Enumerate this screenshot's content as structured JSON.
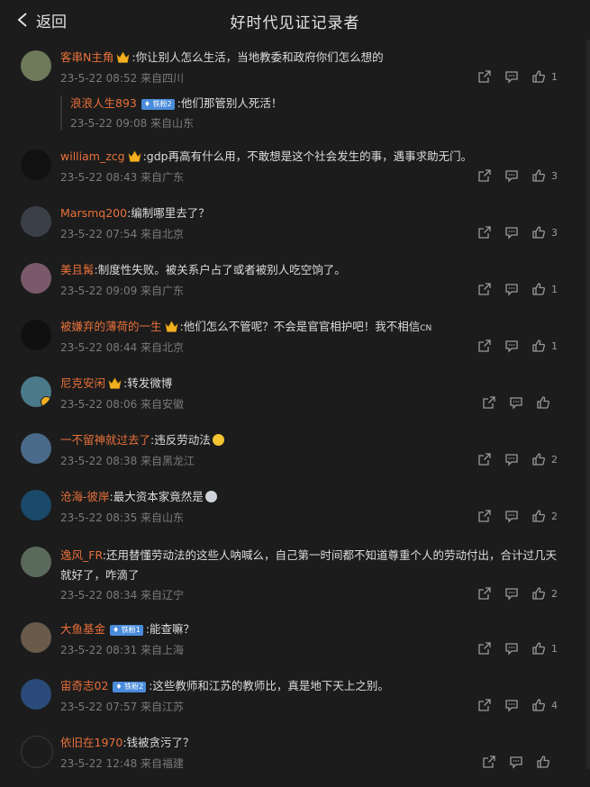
{
  "header": {
    "back_label": "返回",
    "title": "好时代见证记录者"
  },
  "comments": [
    {
      "user": "客串N主角",
      "crown": true,
      "tag": "",
      "text": ":你让别人怎么生活，当地教委和政府你们怎么想的",
      "time": "23-5-22 08:52",
      "location": "来自四川",
      "likes": "1",
      "avatar_color": "#6e7a5a",
      "reply": {
        "user": "浪浪人生893",
        "tag": "铁粉2",
        "text": ":他们那管别人死活！",
        "time": "23-5-22 09:08",
        "location": "来自山东"
      }
    },
    {
      "user": "william_zcg",
      "crown": true,
      "tag": "",
      "text": ":gdp再高有什么用，不敢想是这个社会发生的事，遇事求助无门。",
      "time": "23-5-22 08:43",
      "location": "来自广东",
      "likes": "3",
      "avatar_color": "#111111"
    },
    {
      "user": "Marsmq200",
      "crown": false,
      "tag": "",
      "text": ":编制哪里去了？",
      "time": "23-5-22 07:54",
      "location": "来自北京",
      "likes": "3",
      "avatar_color": "#3a3f48"
    },
    {
      "user": "美且髯",
      "crown": false,
      "tag": "",
      "text": ":制度性失败。被关系户占了或者被别人吃空饷了。",
      "time": "23-5-22 09:09",
      "location": "来自广东",
      "likes": "1",
      "avatar_color": "#7a5a6a"
    },
    {
      "user": "被嫌弃的薄荷的一生",
      "crown": true,
      "tag": "",
      "text": ":他们怎么不管呢？不会是官官相护吧！我不相信",
      "suffix": "CN",
      "time": "23-5-22 08:44",
      "location": "来自北京",
      "likes": "1",
      "avatar_color": "#101010"
    },
    {
      "user": "尼克安闲",
      "crown": true,
      "tag": "",
      "text": ":转发微博",
      "time": "23-5-22 08:06",
      "location": "来自安徽",
      "likes": "",
      "avatar_color": "#4a7a8a",
      "badge": true
    },
    {
      "user": "一不留神就过去了",
      "crown": false,
      "tag": "",
      "text": ":违反劳动法",
      "emoji": "grin",
      "time": "23-5-22 08:38",
      "location": "来自黑龙江",
      "likes": "2",
      "avatar_color": "#4a6a8a"
    },
    {
      "user": "沧海-彼岸",
      "crown": false,
      "tag": "",
      "text": ":最大资本家竟然是",
      "emoji": "ghost",
      "time": "23-5-22 08:35",
      "location": "来自山东",
      "likes": "2",
      "avatar_color": "#1a4a6a"
    },
    {
      "user": "逸风_FR",
      "crown": false,
      "tag": "",
      "text": ":还用替懂劳动法的这些人呐喊么，自己第一时间都不知道尊重个人的劳动付出，合计过几天就好了，咋滴了",
      "time": "23-5-22 08:34",
      "location": "来自辽宁",
      "likes": "2",
      "avatar_color": "#5a6a5a",
      "wrap": true
    },
    {
      "user": "大鱼基金",
      "crown": false,
      "tag": "铁粉1",
      "text": ":能查嘛？",
      "time": "23-5-22 08:31",
      "location": "来自上海",
      "likes": "1",
      "avatar_color": "#6a5a4a"
    },
    {
      "user": "宙奇志02",
      "crown": false,
      "tag": "铁粉2",
      "text": ":这些教师和江苏的教师比，真是地下天上之别。",
      "time": "23-5-22 07:57",
      "location": "来自江苏",
      "likes": "4",
      "avatar_color": "#2a4a7a"
    },
    {
      "user": "依旧在1970",
      "crown": false,
      "tag": "",
      "text": ":钱被贪污了？",
      "time": "23-5-22 12:48",
      "location": "来自福建",
      "likes": "",
      "avatar_color": "#1c1c1c"
    }
  ]
}
